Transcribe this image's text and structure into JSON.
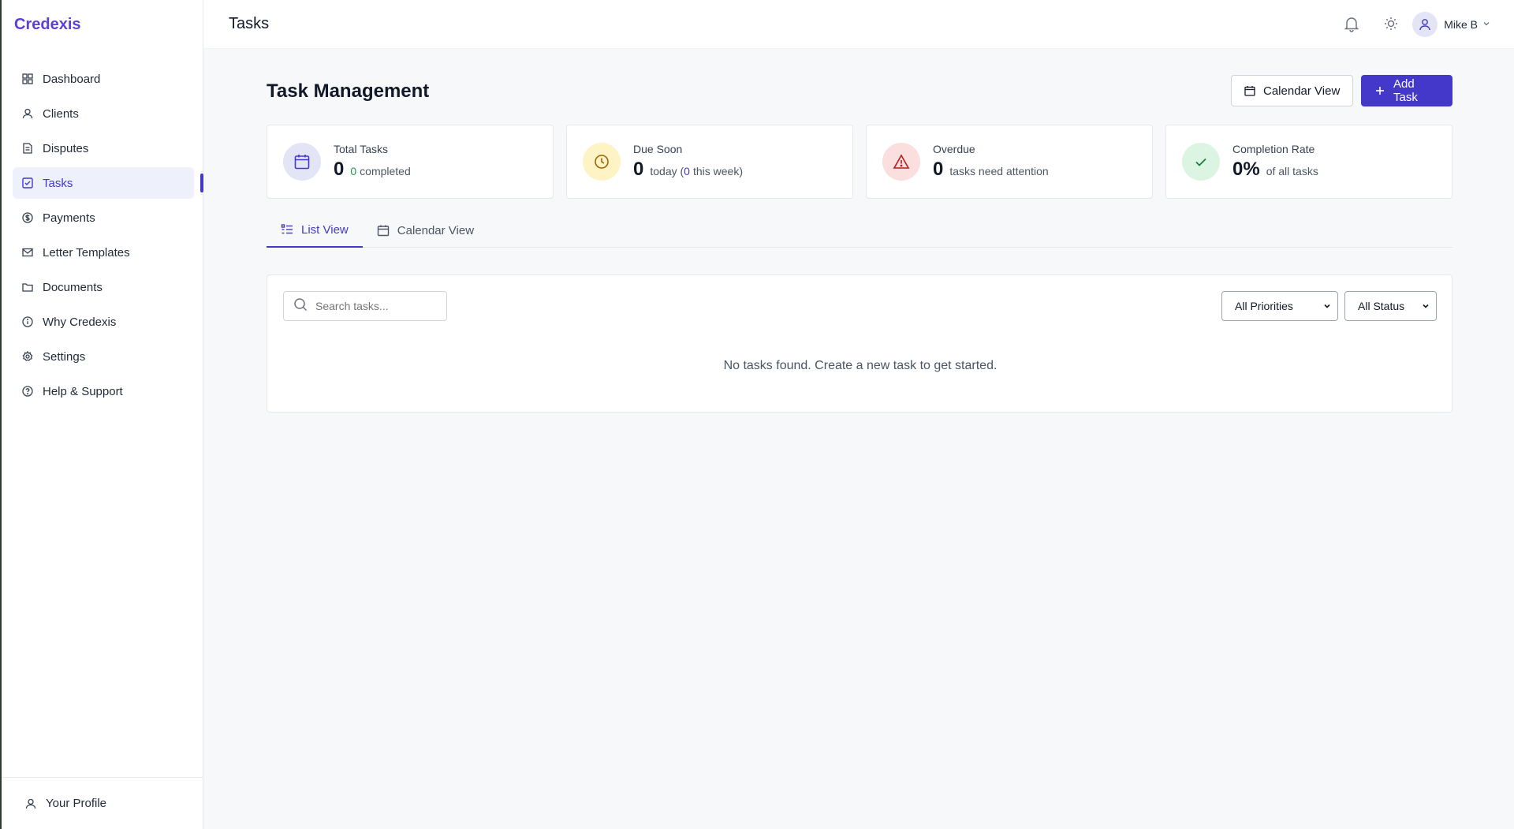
{
  "app": {
    "brand": "Credexis"
  },
  "sidebar": {
    "items": [
      {
        "label": "Dashboard",
        "icon": "grid-icon"
      },
      {
        "label": "Clients",
        "icon": "user-icon"
      },
      {
        "label": "Disputes",
        "icon": "document-icon"
      },
      {
        "label": "Tasks",
        "icon": "checkbox-icon",
        "active": true
      },
      {
        "label": "Payments",
        "icon": "dollar-icon"
      },
      {
        "label": "Letter Templates",
        "icon": "mail-icon"
      },
      {
        "label": "Documents",
        "icon": "folder-icon"
      },
      {
        "label": "Why Credexis",
        "icon": "info-icon"
      },
      {
        "label": "Settings",
        "icon": "gear-icon"
      },
      {
        "label": "Help & Support",
        "icon": "help-icon"
      }
    ],
    "footer": {
      "label": "Your Profile"
    }
  },
  "topbar": {
    "title": "Tasks",
    "user_name": "Mike B"
  },
  "main": {
    "page_title": "Task Management",
    "calendar_button": "Calendar View",
    "add_button": "Add Task",
    "stats": [
      {
        "label": "Total Tasks",
        "value": "0",
        "sub_value": "0",
        "sub_text": "completed"
      },
      {
        "label": "Due Soon",
        "value": "0",
        "sub_text": "today (",
        "sub_value": "0",
        "sub_text2": "this week)"
      },
      {
        "label": "Overdue",
        "value": "0",
        "sub_text": "tasks need attention"
      },
      {
        "label": "Completion Rate",
        "value": "0%",
        "sub_text": "of all tasks"
      }
    ],
    "tabs": [
      {
        "label": "List View",
        "active": true
      },
      {
        "label": "Calendar View"
      }
    ],
    "search": {
      "placeholder": "Search tasks..."
    },
    "filters": {
      "priority": "All Priorities",
      "status": "All Status"
    },
    "empty_message": "No tasks found. Create a new task to get started."
  },
  "colors": {
    "brand": "#5b3fd6",
    "accent": "#4338ca",
    "completed_green": "#16a34a",
    "due_yellow_bg": "#fdf3c4",
    "overdue_red_bg": "#fbdede",
    "complete_green_bg": "#dcf5e3",
    "total_blue_bg": "#e3e5f7"
  }
}
